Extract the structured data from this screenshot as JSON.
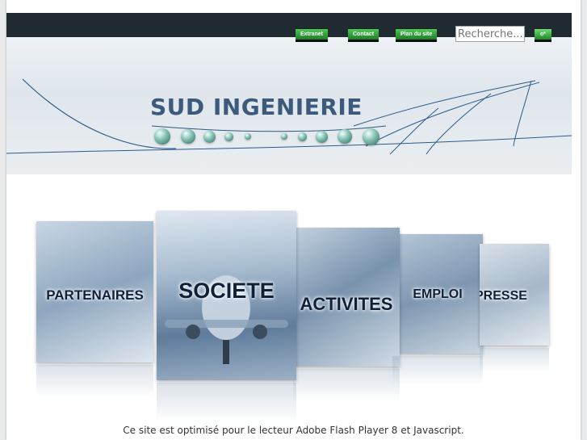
{
  "header": {
    "nav": [
      "Extranet",
      "Contact",
      "Plan du site"
    ],
    "search": {
      "placeholder": "Recherche..."
    },
    "search_button": "o*"
  },
  "brand": {
    "name": "SUD INGENIERIE"
  },
  "carousel": {
    "panels": [
      "PARTENAIRES",
      "SOCIETE",
      "ACTIVITES",
      "EMPLOI",
      "PRESSE"
    ]
  },
  "footer": {
    "notice": "Ce site est optimisé pour le lecteur Adobe Flash Player 8 et Javascript."
  }
}
